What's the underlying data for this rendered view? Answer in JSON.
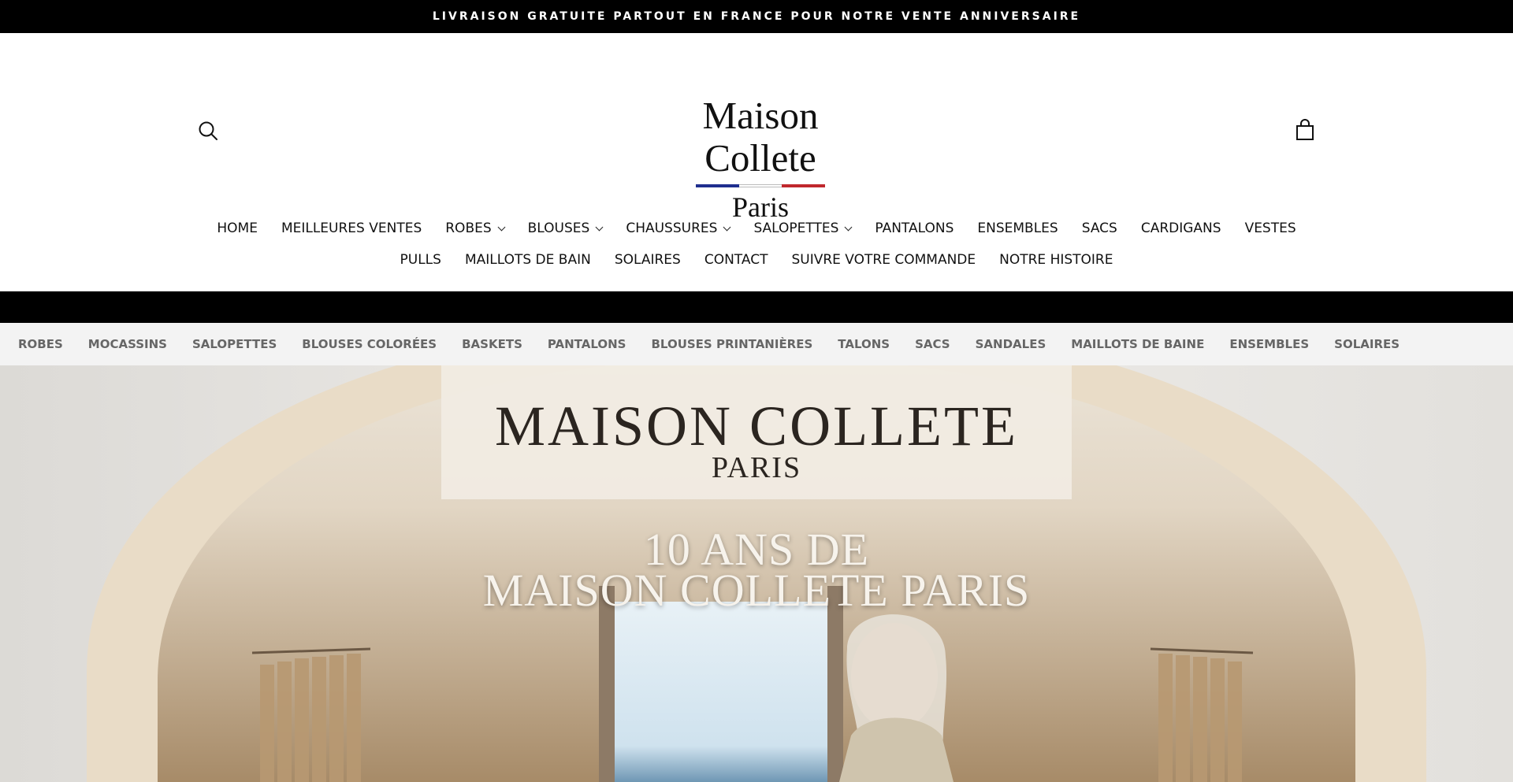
{
  "announcement": {
    "text": "LIVRAISON GRATUITE PARTOUT EN FRANCE POUR NOTRE VENTE ANNIVERSAIRE"
  },
  "header": {
    "logo": {
      "name": "Maison Collete",
      "city": "Paris",
      "flag_colors": [
        "#1f2f8f",
        "#ffffff",
        "#c0282d"
      ]
    }
  },
  "nav": {
    "row1": [
      {
        "label": "HOME",
        "dropdown": false
      },
      {
        "label": "MEILLEURES VENTES",
        "dropdown": false
      },
      {
        "label": "ROBES",
        "dropdown": true
      },
      {
        "label": "BLOUSES",
        "dropdown": true
      },
      {
        "label": "CHAUSSURES",
        "dropdown": true
      },
      {
        "label": "SALOPETTES",
        "dropdown": true
      },
      {
        "label": "PANTALONS",
        "dropdown": false
      },
      {
        "label": "ENSEMBLES",
        "dropdown": false
      },
      {
        "label": "SACS",
        "dropdown": false
      },
      {
        "label": "CARDIGANS",
        "dropdown": false
      },
      {
        "label": "VESTES",
        "dropdown": false
      }
    ],
    "row2": [
      {
        "label": "PULLS",
        "dropdown": false
      },
      {
        "label": "MAILLOTS DE BAIN",
        "dropdown": false
      },
      {
        "label": "SOLAIRES",
        "dropdown": false
      },
      {
        "label": "CONTACT",
        "dropdown": false
      },
      {
        "label": "SUIVRE VOTRE COMMANDE",
        "dropdown": false
      },
      {
        "label": "NOTRE HISTOIRE",
        "dropdown": false
      }
    ]
  },
  "categories": [
    "ROBES",
    "MOCASSINS",
    "SALOPETTES",
    "BLOUSES COLORÉES",
    "BASKETS",
    "PANTALONS",
    "BLOUSES PRINTANIÈRES",
    "TALONS",
    "SACS",
    "SANDALES",
    "MAILLOTS DE BAINE",
    "ENSEMBLES",
    "SOLAIRES"
  ],
  "hero": {
    "brand": "MAISON COLLETE",
    "city": "PARIS",
    "headline_line1": "10 ANS DE",
    "headline_line2": "MAISON COLLETE PARIS"
  },
  "icons": {
    "search": "search-icon",
    "cart": "shopping-bag-icon",
    "dropdown": "chevron-down-icon"
  },
  "colors": {
    "announcement_bg": "#000000",
    "category_bar_bg": "#f3f3f3",
    "category_text": "#666666"
  }
}
